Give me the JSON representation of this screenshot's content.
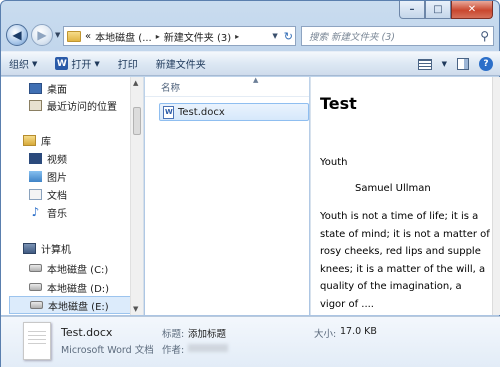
{
  "window": {
    "caption_buttons": [
      "minimize",
      "maximize",
      "close"
    ]
  },
  "address_bar": {
    "overflow": "«",
    "crumbs": [
      "本地磁盘 (...",
      "新建文件夹 (3)"
    ]
  },
  "search": {
    "placeholder": "搜索 新建文件夹 (3)"
  },
  "toolbar": {
    "organize": "组织",
    "open": "打开",
    "print": "打印",
    "new_folder": "新建文件夹"
  },
  "nav": {
    "items": [
      {
        "label": "桌面",
        "icon": "desktop-icon"
      },
      {
        "label": "最近访问的位置",
        "icon": "recent-places-icon"
      },
      {
        "label": "库",
        "icon": "library-icon"
      },
      {
        "label": "视频",
        "icon": "video-icon"
      },
      {
        "label": "图片",
        "icon": "pictures-icon"
      },
      {
        "label": "文档",
        "icon": "documents-icon"
      },
      {
        "label": "音乐",
        "icon": "music-icon"
      },
      {
        "label": "计算机",
        "icon": "computer-icon"
      },
      {
        "label": "本地磁盘 (C:)",
        "icon": "disk-icon"
      },
      {
        "label": "本地磁盘 (D:)",
        "icon": "disk-icon"
      },
      {
        "label": "本地磁盘 (E:)",
        "icon": "disk-icon",
        "selected": true
      }
    ]
  },
  "filelist": {
    "column_name": "名称",
    "files": [
      {
        "name": "Test.docx",
        "icon": "word-doc-icon"
      }
    ]
  },
  "preview": {
    "title": "Test",
    "subtitle": "Youth",
    "author": "Samuel Ullman",
    "body": "Youth is not a time of life; it is a state of mind; it is not a matter of rosy cheeks, red lips and supple knees; it is a matter of the will, a quality of the imagination, a vigor of ...."
  },
  "details": {
    "name": "Test.docx",
    "type": "Microsoft Word 文档",
    "title_label": "标题:",
    "title_value": "添加标题",
    "author_label": "作者:",
    "size_label": "大小:",
    "size_value": "17.0 KB"
  }
}
